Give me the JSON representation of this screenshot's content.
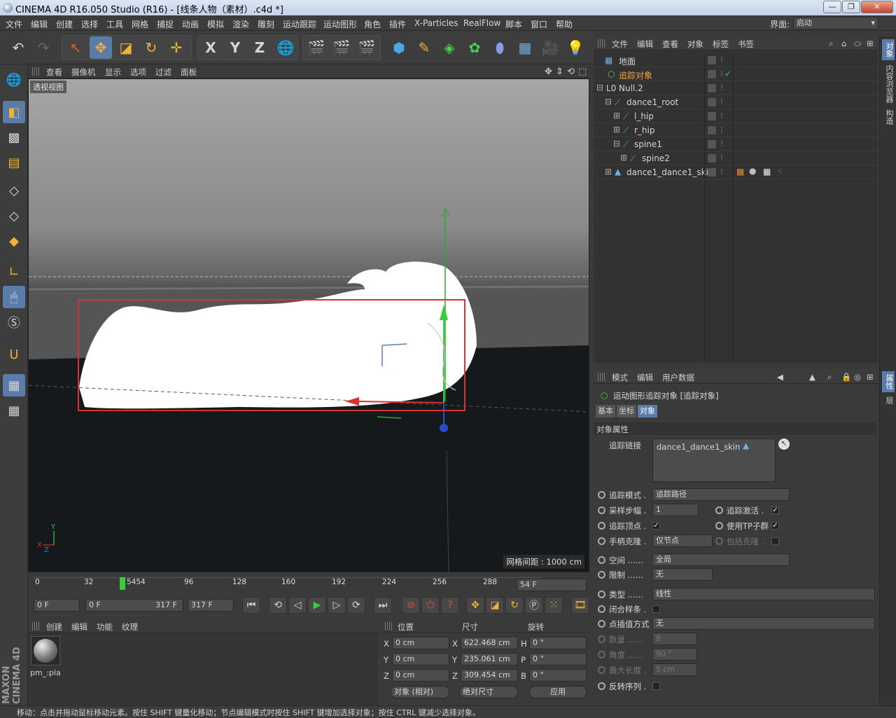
{
  "window": {
    "title": "CINEMA 4D R16.050 Studio (R16) - [线条人物（素材）.c4d *]"
  },
  "menu": [
    "文件",
    "编辑",
    "创建",
    "选择",
    "工具",
    "网格",
    "捕捉",
    "动画",
    "模拟",
    "渲染",
    "雕刻",
    "运动跟踪",
    "运动图形",
    "角色",
    "插件",
    "X-Particles",
    "RealFlow",
    "脚本",
    "窗口",
    "帮助"
  ],
  "layout": {
    "label": "界面:",
    "value": "启动"
  },
  "toolbar": {
    "axis_x": "X",
    "axis_y": "Y",
    "axis_z": "Z"
  },
  "viewport": {
    "menu": [
      "查看",
      "摄像机",
      "显示",
      "选项",
      "过滤",
      "面板"
    ],
    "label": "透视视图",
    "grid_info": "网格间距 : 1000 cm",
    "axis_x": "X",
    "axis_y": "Y",
    "axis_z": "Z"
  },
  "timeline": {
    "ticks": [
      "0",
      "32",
      "5454",
      "96",
      "128",
      "160",
      "192",
      "224",
      "256",
      "288",
      "3:"
    ],
    "current": "54 F"
  },
  "transport": {
    "start": "0 F",
    "range_start": "0 F",
    "range_end": "317 F",
    "end": "317 F"
  },
  "material": {
    "menu": [
      "创建",
      "编辑",
      "功能",
      "纹理"
    ],
    "item": "pm_:pla"
  },
  "coords": {
    "headers": [
      "位置",
      "尺寸",
      "旋转"
    ],
    "rows": [
      {
        "axis": "X",
        "pos": "0 cm",
        "size_axis": "X",
        "size": "622.468 cm",
        "rot_axis": "H",
        "rot": "0 °"
      },
      {
        "axis": "Y",
        "pos": "0 cm",
        "size_axis": "Y",
        "size": "235.061 cm",
        "rot_axis": "P",
        "rot": "0 °"
      },
      {
        "axis": "Z",
        "pos": "0 cm",
        "size_axis": "Z",
        "size": "309.454 cm",
        "rot_axis": "B",
        "rot": "0 °"
      }
    ],
    "mode": "对象 (相对)",
    "size_mode": "绝对尺寸",
    "apply": "应用"
  },
  "status": "移动：点击并拖动鼠标移动元素。按住 SHIFT 键量化移动；节点编辑模式时按住 SHIFT 键增加选择对象；按住 CTRL 键减少选择对象。",
  "object_manager": {
    "menu": [
      "文件",
      "编辑",
      "查看",
      "对象",
      "标签",
      "书签"
    ],
    "items": [
      {
        "name": "地面",
        "indent": 0,
        "icon": "floor"
      },
      {
        "name": "追踪对象",
        "indent": 0,
        "icon": "tracer",
        "highlight": true
      },
      {
        "name": "Null.2",
        "indent": 0,
        "icon": "null"
      },
      {
        "name": "dance1_root",
        "indent": 1,
        "icon": "bone"
      },
      {
        "name": "l_hip",
        "indent": 2,
        "icon": "bone"
      },
      {
        "name": "r_hip",
        "indent": 2,
        "icon": "bone"
      },
      {
        "name": "spine1",
        "indent": 2,
        "icon": "bone"
      },
      {
        "name": "spine2",
        "indent": 3,
        "icon": "bone"
      },
      {
        "name": "dance1_dance1_skin",
        "indent": 1,
        "icon": "mesh"
      }
    ]
  },
  "attributes": {
    "menu": [
      "模式",
      "编辑",
      "用户数据"
    ],
    "title": "运动图形追踪对象 [追踪对象]",
    "tabs": [
      "基本",
      "坐标",
      "对象"
    ],
    "section": "对象属性",
    "link_label": "追踪链接",
    "link_value": "dance1_dance1_skin",
    "fields": {
      "trace_mode_label": "追踪模式 .",
      "trace_mode": "追踪路径",
      "sample_step_label": "采样步幅 .",
      "sample_step": "1",
      "trace_active_label": "追踪激活 .",
      "trace_vertices_label": "追踪顶点 .",
      "use_tp_label": "使用TP子群",
      "handle_clone_label": "手柄克隆 .",
      "handle_clone": "仅节点",
      "include_clone_label": "包括克隆 .",
      "space_label": "空间 ......",
      "space": "全局",
      "limit_label": "限制 ......",
      "limit": "无",
      "type_label": "类型 ......",
      "type": "线性",
      "closed_label": "闭合样条 .",
      "interp_label": "点插值方式",
      "interp": "无",
      "count_label": "数量 ......",
      "count": "8",
      "angle_label": "角度 ......",
      "angle": "90 °",
      "max_len_label": "最大长度 .",
      "max_len": "5 cm",
      "reverse_label": "反转序列 ."
    }
  },
  "right_tabs": [
    "对象",
    "内容浏览器",
    "构造",
    "属性",
    "层"
  ],
  "brand": "MAXON CINEMA 4D"
}
